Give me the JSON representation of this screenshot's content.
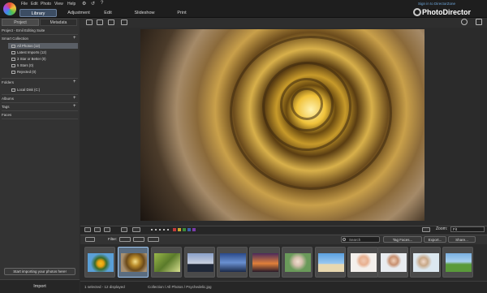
{
  "titlebar": {
    "menu": [
      "File",
      "Edit",
      "Photo",
      "View",
      "Help"
    ],
    "window_buttons": [
      "⚙",
      "↺",
      "?"
    ],
    "tabs": [
      "Library",
      "Adjustment",
      "Edit",
      "Slideshow",
      "Print"
    ],
    "active_tab": "Library",
    "brand": "PhotoDirector",
    "signin": "Sign in to DirectorZone"
  },
  "left_panel": {
    "tabs": [
      "Project",
      "Metadata"
    ],
    "project_title": "Project - Emil Editing Suite",
    "sections": {
      "smart_collection": "Smart Collection",
      "folders": "Folders",
      "albums": "Albums",
      "tags": "Tags",
      "faces": "Faces"
    },
    "smart_items": [
      "All Photos (12)",
      "Latest Imports (12)",
      "3 Star or Better (0)",
      "5 Stars (0)",
      "Rejected (0)"
    ],
    "folder_items": [
      "Local Disk (C:)"
    ],
    "import_hint": "Start importing your photos here!",
    "import_button": "Import"
  },
  "filmstrip_controls": {
    "zoom_label": "Zoom:",
    "zoom_value": "Fit"
  },
  "filter_bar": {
    "filter_label": "Filter:",
    "search_placeholder": "Search",
    "tag_faces": "Tag Faces...",
    "export": "Export...",
    "share": "Share..."
  },
  "status": {
    "selection": "1 selected - 12 displayed",
    "path": "Collection / All Photos / Psychedelic.jpg"
  },
  "icons": [
    "gear-icon",
    "search-icon",
    "grid-icon",
    "import-icon",
    "star-icon",
    "flag-icon",
    "zoom-icon"
  ]
}
